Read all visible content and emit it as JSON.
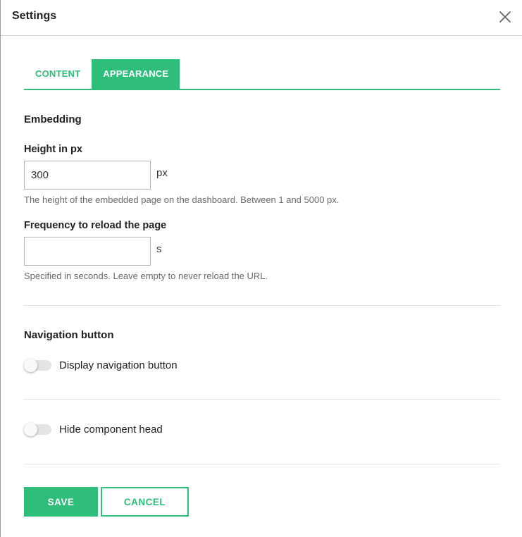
{
  "dialog": {
    "title": "Settings",
    "close_icon": "close-icon"
  },
  "tabs": [
    {
      "label": "CONTENT",
      "active": false
    },
    {
      "label": "APPEARANCE",
      "active": true
    }
  ],
  "embedding": {
    "title": "Embedding",
    "height": {
      "label": "Height in px",
      "value": "300",
      "unit": "px",
      "help": "The height of the embedded page on the dashboard. Between 1 and 5000 px."
    },
    "reload": {
      "label": "Frequency to reload the page",
      "value": "",
      "unit": "s",
      "help": "Specified in seconds. Leave empty to never reload the URL."
    }
  },
  "navigation": {
    "title": "Navigation button",
    "display_toggle": {
      "label": "Display navigation button",
      "checked": false
    }
  },
  "component_head": {
    "hide_toggle": {
      "label": "Hide component head",
      "checked": false
    }
  },
  "actions": {
    "save_label": "SAVE",
    "cancel_label": "CANCEL"
  },
  "colors": {
    "accent": "#2fbd7a",
    "divider": "#e3e3e3",
    "help_text": "#6b6b6b"
  }
}
